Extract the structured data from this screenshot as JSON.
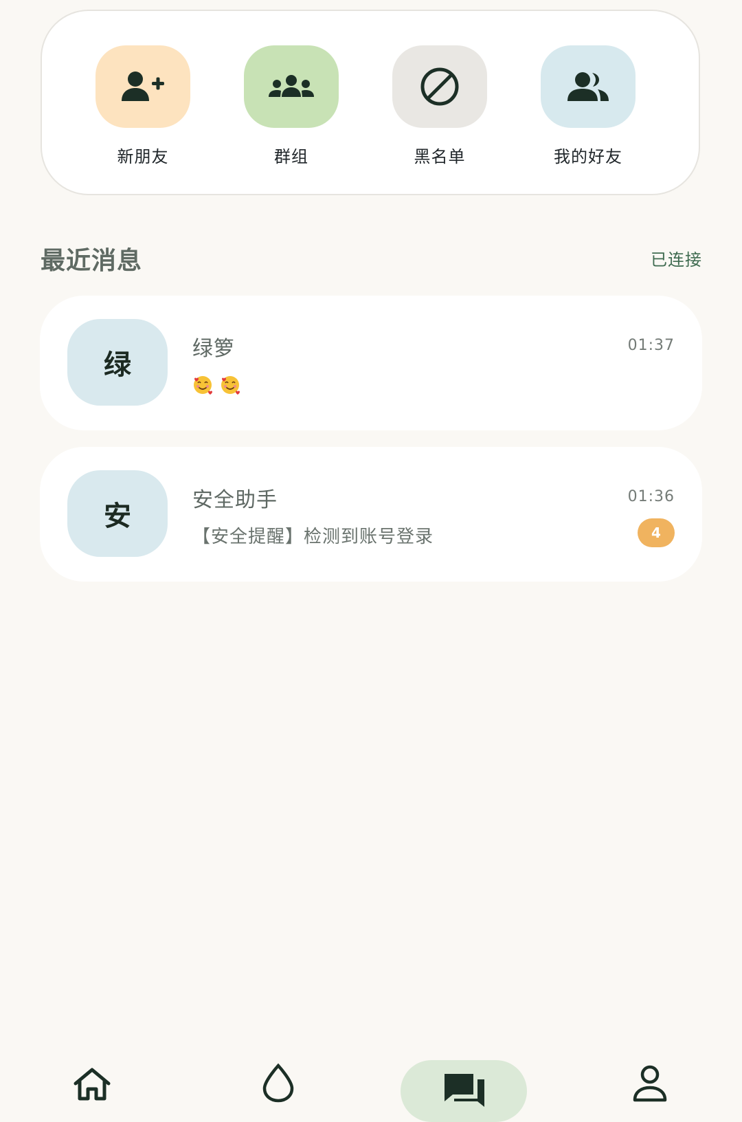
{
  "quick_actions": [
    {
      "label": "新朋友",
      "icon": "add-user-icon",
      "bg": "#fde3bf"
    },
    {
      "label": "群组",
      "icon": "group-icon",
      "bg": "#c8e2b5"
    },
    {
      "label": "黑名单",
      "icon": "block-icon",
      "bg": "#e9e7e3"
    },
    {
      "label": "我的好友",
      "icon": "friends-icon",
      "bg": "#d7e9ee"
    }
  ],
  "section": {
    "title": "最近消息",
    "status": "已连接"
  },
  "messages": [
    {
      "avatar_char": "绿",
      "name": "绿箩",
      "preview_emoji": [
        "smiling-face-with-hearts-icon",
        "smiling-face-with-hearts-icon"
      ],
      "time": "01:37"
    },
    {
      "avatar_char": "安",
      "name": "安全助手",
      "preview": "【安全提醒】检测到账号登录",
      "time": "01:36",
      "unread": "4"
    }
  ],
  "bottom_nav": {
    "items": [
      {
        "icon": "home-icon",
        "active": false
      },
      {
        "icon": "drop-icon",
        "active": false
      },
      {
        "icon": "chat-icon",
        "active": true
      },
      {
        "icon": "profile-icon",
        "active": false
      }
    ]
  },
  "colors": {
    "background": "#faf8f4",
    "accent_green": "#3f6b50",
    "badge_orange": "#f0b35f",
    "avatar_bg": "#d9e9ee",
    "nav_active_bg": "#dbe9d7"
  }
}
